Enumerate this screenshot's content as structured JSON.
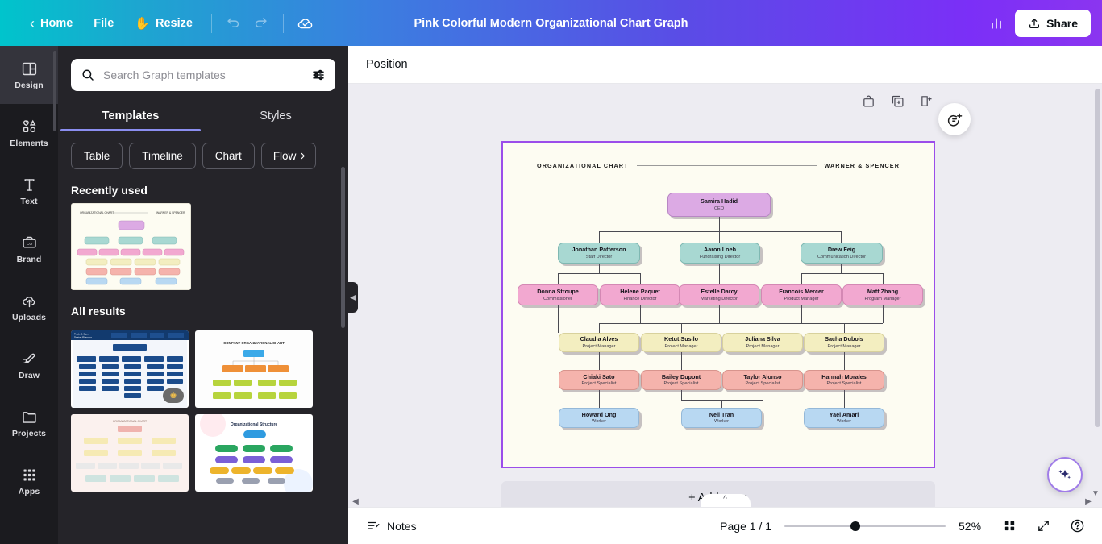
{
  "topbar": {
    "back_icon": "chevron-left-icon",
    "home_label": "Home",
    "file_label": "File",
    "resize_label": "Resize",
    "resize_emoji": "✋",
    "undo_icon": "undo-icon",
    "redo_icon": "redo-icon",
    "cloud_icon": "cloud-saved-icon",
    "title": "Pink Colorful Modern Organizational Chart Graph",
    "insights_icon": "bar-chart-icon",
    "share_label": "Share",
    "share_icon": "upload-icon",
    "gradient_start": "#00c4cc",
    "gradient_end": "#8b35f0"
  },
  "rail": {
    "items": [
      {
        "label": "Design",
        "icon": "design-icon",
        "active": true
      },
      {
        "label": "Elements",
        "icon": "elements-icon",
        "active": false
      },
      {
        "label": "Text",
        "icon": "text-icon",
        "active": false
      },
      {
        "label": "Brand",
        "icon": "brand-icon",
        "active": false
      },
      {
        "label": "Uploads",
        "icon": "uploads-icon",
        "active": false
      },
      {
        "label": "Draw",
        "icon": "draw-icon",
        "active": false
      },
      {
        "label": "Projects",
        "icon": "projects-icon",
        "active": false
      },
      {
        "label": "Apps",
        "icon": "apps-icon",
        "active": false
      }
    ]
  },
  "panel": {
    "search": {
      "placeholder": "Search Graph templates",
      "value": "",
      "icon": "search-icon",
      "filter_icon": "filter-sliders-icon"
    },
    "tabs": [
      {
        "label": "Templates",
        "active": true
      },
      {
        "label": "Styles",
        "active": false
      }
    ],
    "chips": [
      "Table",
      "Timeline",
      "Chart",
      "Flow"
    ],
    "chips_more_icon": "chevron-right-icon",
    "recently_used_label": "Recently used",
    "all_results_label": "All results",
    "results": [
      {
        "name": "org-chart-dark-blue",
        "premium": true
      },
      {
        "name": "company-organizational-chart",
        "premium": false
      },
      {
        "name": "organizational-chart-pink",
        "premium": false
      },
      {
        "name": "organizational-structure",
        "premium": false
      }
    ]
  },
  "editor": {
    "position_label": "Position",
    "page_tools": [
      {
        "icon": "lock-page-icon",
        "name": "lock-page"
      },
      {
        "icon": "duplicate-page-icon",
        "name": "duplicate-page"
      },
      {
        "icon": "add-page-icon",
        "name": "add-page-tool"
      }
    ],
    "comment_icon": "add-comment-icon",
    "add_page_label": "+ Add page",
    "magic_icon": "magic-sparkle-icon",
    "collapse_icon": "chevron-up-icon"
  },
  "bottombar": {
    "notes_label": "Notes",
    "notes_icon": "notes-icon",
    "page_indicator": "Page 1 / 1",
    "zoom_value": "52%",
    "zoom_percent": 52,
    "grid_icon": "grid-view-icon",
    "fullscreen_icon": "fullscreen-icon",
    "help_icon": "help-icon"
  },
  "chart_data": {
    "type": "diagram",
    "title": "ORGANIZATIONAL CHART",
    "company": "WARNER & SPENCER",
    "page_border_color": "#9b4dea",
    "page_background": "#fdfcf2",
    "levels": [
      {
        "level": 1,
        "color": "#dcaae4",
        "nodes": [
          {
            "name": "Samira Hadid",
            "role": "CEO"
          }
        ]
      },
      {
        "level": 2,
        "color": "#a8d8d2",
        "nodes": [
          {
            "name": "Jonathan Patterson",
            "role": "Staff Director"
          },
          {
            "name": "Aaron Loeb",
            "role": "Fundraising Director"
          },
          {
            "name": "Drew Feig",
            "role": "Communication Director"
          }
        ]
      },
      {
        "level": 3,
        "color": "#f2a8d0",
        "nodes": [
          {
            "name": "Donna Stroupe",
            "role": "Commissioner"
          },
          {
            "name": "Helene Paquet",
            "role": "Finance Director"
          },
          {
            "name": "Estelle Darcy",
            "role": "Marketing Director"
          },
          {
            "name": "Francois Mercer",
            "role": "Product Manager"
          },
          {
            "name": "Matt Zhang",
            "role": "Program Manager"
          }
        ]
      },
      {
        "level": 4,
        "color": "#f3eec0",
        "nodes": [
          {
            "name": "Claudia Alves",
            "role": "Project Manager"
          },
          {
            "name": "Ketut Susilo",
            "role": "Project Manager"
          },
          {
            "name": "Juliana Silva",
            "role": "Project Manager"
          },
          {
            "name": "Sacha Dubois",
            "role": "Project Manager"
          }
        ]
      },
      {
        "level": 5,
        "color": "#f5b3ac",
        "nodes": [
          {
            "name": "Chiaki Sato",
            "role": "Project Specialist"
          },
          {
            "name": "Bailey Dupont",
            "role": "Project Specialist"
          },
          {
            "name": "Taylor Alonso",
            "role": "Project Specialist"
          },
          {
            "name": "Hannah Morales",
            "role": "Project Specialist"
          }
        ]
      },
      {
        "level": 6,
        "color": "#b8d8f2",
        "nodes": [
          {
            "name": "Howard Ong",
            "role": "Worker"
          },
          {
            "name": "Neil Tran",
            "role": "Worker"
          },
          {
            "name": "Yael Amari",
            "role": "Worker"
          }
        ]
      }
    ]
  }
}
